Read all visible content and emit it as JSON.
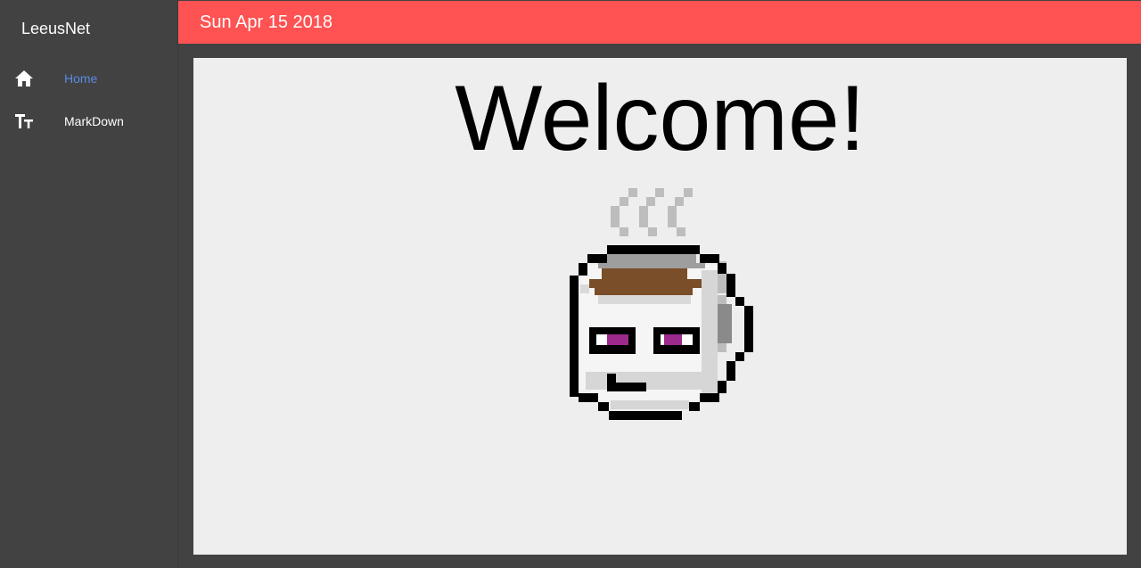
{
  "app": {
    "brand": "LeeusNet"
  },
  "sidebar": {
    "items": [
      {
        "label": "Home",
        "icon": "home-icon",
        "active": true
      },
      {
        "label": "MarkDown",
        "icon": "text-size-icon",
        "active": false
      }
    ]
  },
  "header": {
    "date": "Sun Apr 15 2018"
  },
  "main": {
    "heading": "Welcome!"
  },
  "colors": {
    "topbar": "#ff5252",
    "sidebar": "#424242",
    "content": "#eeeeee",
    "active_link": "#5a8ae0",
    "coffee": "#7a4e28",
    "eyes": "#9b2a8c"
  }
}
